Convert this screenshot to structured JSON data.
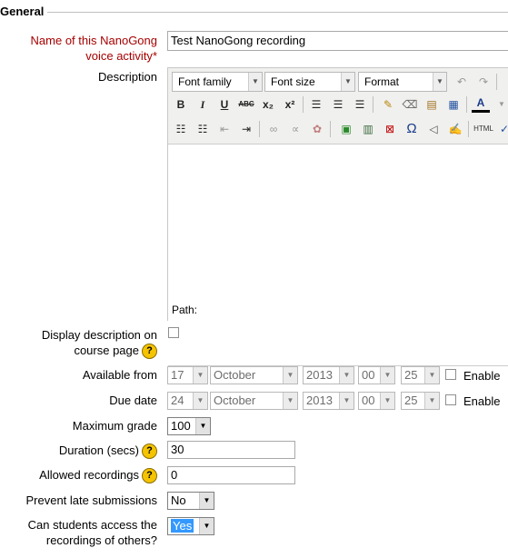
{
  "section": {
    "legend": "General"
  },
  "name_field": {
    "label_line1": "Name of this NanoGong",
    "label_line2": "voice activity",
    "required_marker": "*",
    "value": "Test NanoGong recording"
  },
  "description": {
    "label": "Description",
    "font_family": "Font family",
    "font_size": "Font size",
    "format": "Format",
    "toolbar2": [
      "B",
      "I",
      "U",
      "ABC",
      "x₂",
      "x²"
    ],
    "toolbar3_omega": "Ω",
    "html_label": "HTML",
    "path_label": "Path:"
  },
  "display_description": {
    "label_line1": "Display description on",
    "label_line2": "course page",
    "checked": false
  },
  "available_from": {
    "label": "Available from",
    "day": "17",
    "month": "October",
    "year": "2013",
    "hour": "00",
    "minute": "25",
    "enable_label": "Enable",
    "enabled": false
  },
  "due_date": {
    "label": "Due date",
    "day": "24",
    "month": "October",
    "year": "2013",
    "hour": "00",
    "minute": "25",
    "enable_label": "Enable",
    "enabled": false
  },
  "maximum_grade": {
    "label": "Maximum grade",
    "value": "100"
  },
  "duration": {
    "label": "Duration (secs)",
    "value": "30"
  },
  "allowed_recordings": {
    "label": "Allowed recordings",
    "value": "0"
  },
  "prevent_late": {
    "label": "Prevent late submissions",
    "value": "No"
  },
  "students_access": {
    "label_line1": "Can students access the",
    "label_line2": "recordings of others?",
    "value": "Yes"
  },
  "help_glyph": "?",
  "colors": {
    "required": "#a60000",
    "help_bg": "#f5c400",
    "selection": "#3399ff"
  }
}
